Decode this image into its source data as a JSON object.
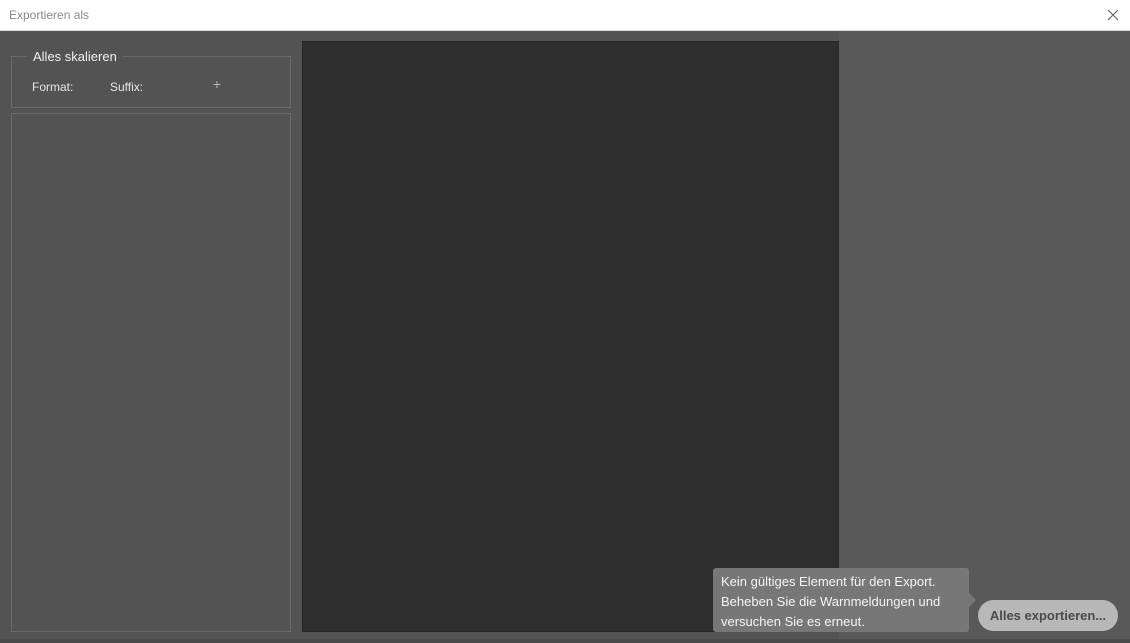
{
  "window": {
    "title": "Exportieren als"
  },
  "left_panel": {
    "group_title": "Alles skalieren",
    "format_label": "Format:",
    "suffix_label": "Suffix:",
    "add_label": "+"
  },
  "tooltip": {
    "line1": "Kein gültiges Element für den Export.",
    "line2": "Beheben Sie die Warnmeldungen und",
    "line3": "versuchen Sie es erneut."
  },
  "actions": {
    "export_all_label": "Alles exportieren..."
  },
  "icons": {
    "close": "close-icon",
    "add": "plus-icon"
  },
  "colors": {
    "dialog_background": "#535353",
    "preview_background": "#2e2e2e",
    "button_background": "#b8b8b8",
    "tooltip_background": "#777777"
  }
}
